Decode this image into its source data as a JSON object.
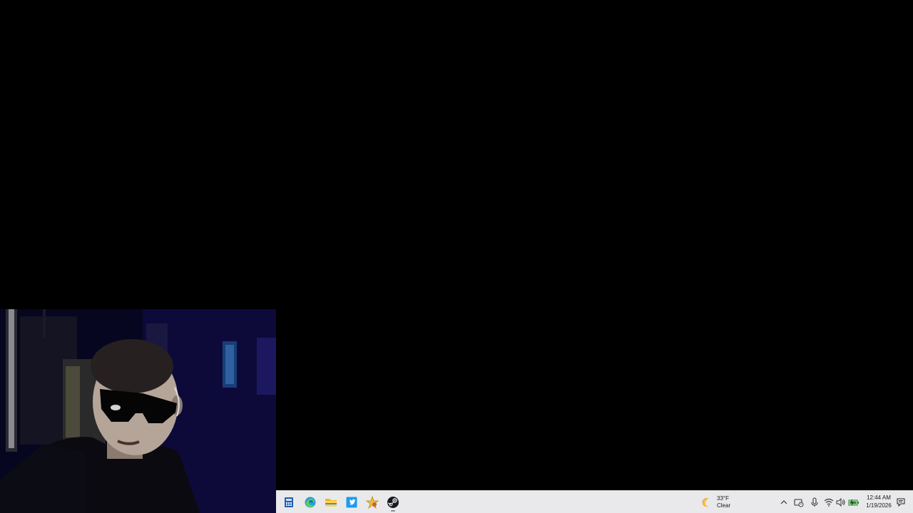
{
  "desktop": {
    "background_color": "#000000"
  },
  "webcam_overlay": {
    "description_icon": "webcam-feed"
  },
  "taskbar": {
    "pinned_apps": [
      {
        "icon": "calculator-icon",
        "color": "#1f5fb0"
      },
      {
        "icon": "edge-icon",
        "color": "#2a9bd6"
      },
      {
        "icon": "file-explorer-icon",
        "color": "#f3b81a"
      },
      {
        "icon": "twitter-icon",
        "color": "#1d9bf0"
      },
      {
        "icon": "pinball-star-icon",
        "color": "#e8c33a"
      },
      {
        "icon": "steam-icon",
        "color": "#171a21"
      }
    ],
    "weather": {
      "icon": "moon-icon",
      "temperature": "33°F",
      "condition": "Clear"
    },
    "tray": {
      "icons": [
        "chevron-up-icon",
        "sync-icon",
        "microphone-icon",
        "wifi-icon",
        "volume-icon",
        "battery-icon"
      ],
      "accent_battery": "#2f8f2f"
    },
    "clock": {
      "time": "12:44 AM",
      "date": "1/19/2026"
    },
    "notification_icon": "notification-icon"
  }
}
